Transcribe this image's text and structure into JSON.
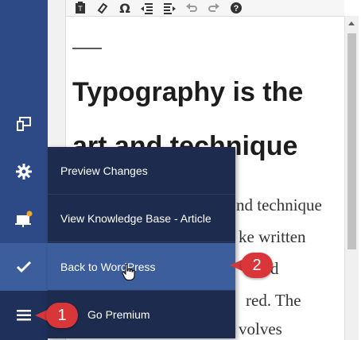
{
  "editor": {
    "heading_line1": "Typography is the",
    "heading_line2": "art and technique",
    "paragraph_fragments": [
      "nd technique",
      "ke written",
      "d",
      "red. The",
      "volves"
    ]
  },
  "menu": {
    "items": [
      {
        "label": "Preview Changes"
      },
      {
        "label": "View Knowledge Base - Article"
      },
      {
        "label": "Back to WordPress"
      },
      {
        "label": "Go Premium"
      }
    ]
  },
  "callouts": {
    "one": "1",
    "two": "2"
  },
  "toolbar": {
    "icons": [
      "paste-text-icon",
      "clear-formatting-icon",
      "special-character-icon",
      "outdent-icon",
      "indent-icon",
      "undo-icon",
      "redo-icon",
      "help-icon"
    ]
  },
  "colors": {
    "sidebar": "#2e4a86",
    "menu": "#1d2b4e",
    "active_item": "#3d5e9c",
    "callout": "#d9363a"
  }
}
